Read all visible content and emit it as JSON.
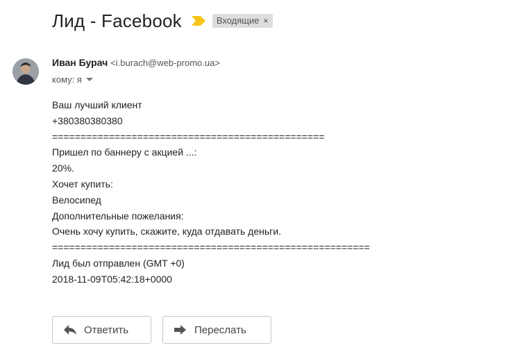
{
  "subject": {
    "title": "Лид - Facebook",
    "label": "Входящие",
    "label_close": "×"
  },
  "sender": {
    "name": "Иван Бурач",
    "email": "<i.burach@web-promo.ua>"
  },
  "recipient": {
    "text": "кому: я"
  },
  "body_lines": [
    "Ваш лучший клиент",
    "+380380380380",
    "================================================",
    "Пришел по баннеру с акцией ...:",
    "20%.",
    "Хочет купить:",
    "Велосипед",
    "Дополнительные пожелания:",
    "Очень хочу купить, скажите, куда отдавать деньги.",
    "========================================================",
    "Лид был отправлен (GMT +0)",
    "2018-11-09T05:42:18+0000"
  ],
  "actions": {
    "reply": "Ответить",
    "forward": "Переслать"
  },
  "colors": {
    "importance_marker": "#f5c518",
    "chip_bg": "#dddddd"
  },
  "icons": {
    "importance": "importance-arrow-icon",
    "reply": "reply-arrow-icon",
    "forward": "forward-arrow-icon"
  }
}
